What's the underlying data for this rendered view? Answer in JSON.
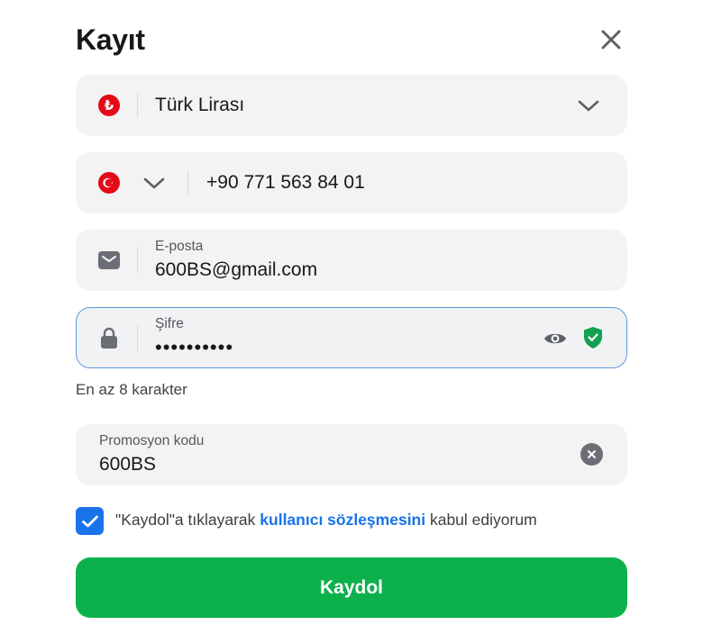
{
  "dialog": {
    "title": "Kayıt"
  },
  "currency": {
    "symbol": "₺",
    "value": "Türk Lirası"
  },
  "phone": {
    "value": "+90 771 563 84 01"
  },
  "email": {
    "label": "E-posta",
    "value": "600BS@gmail.com"
  },
  "password": {
    "label": "Şifre",
    "masked_value": "••••••••••",
    "hint": "En az 8 karakter"
  },
  "promo": {
    "label": "Promosyon kodu",
    "value": "600BS"
  },
  "agreement": {
    "checked": true,
    "prefix": "\"Kaydol\"a tıklayarak ",
    "link": "kullanıcı sözleşmesini",
    "suffix": " kabul ediyorum"
  },
  "submit": {
    "label": "Kaydol"
  },
  "colors": {
    "accent_blue": "#1a73e8",
    "submit_green": "#0db14b",
    "shield_green": "#12a150",
    "flag_red": "#e30a17"
  }
}
